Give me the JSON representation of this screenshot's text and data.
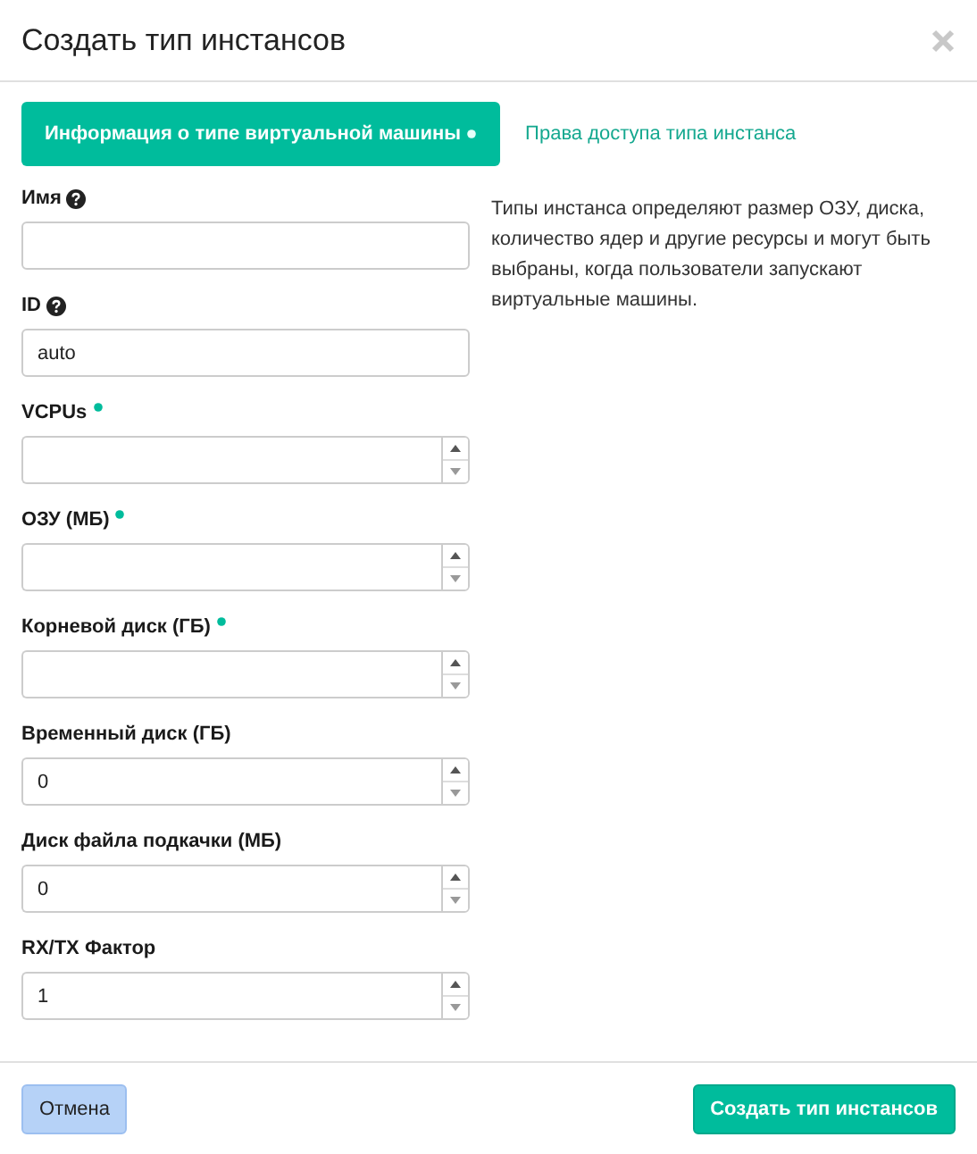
{
  "window": {
    "title": "Создать тип инстансов"
  },
  "tabs": [
    {
      "label": "Информация о типе виртуальной машины",
      "selected": true,
      "required": true
    },
    {
      "label": "Права доступа типа инстанса",
      "selected": false,
      "required": false
    }
  ],
  "fields": [
    {
      "label": "Имя",
      "kind": "text",
      "help": true,
      "required": false
    },
    {
      "label": "ID",
      "kind": "text",
      "help": true,
      "required": false,
      "value": "auto"
    },
    {
      "label": "VCPUs",
      "kind": "number",
      "help": false,
      "required": true
    },
    {
      "label": "ОЗУ (МБ)",
      "kind": "number",
      "help": false,
      "required": true
    },
    {
      "label": "Корневой диск (ГБ)",
      "kind": "number",
      "help": false,
      "required": true
    },
    {
      "label": "Временный диск (ГБ)",
      "kind": "number",
      "help": false,
      "required": false,
      "value": "0"
    },
    {
      "label": "Диск файла подкачки (МБ)",
      "kind": "number",
      "help": false,
      "required": false,
      "value": "0"
    },
    {
      "label": "RX/TX Фактор",
      "kind": "number",
      "help": false,
      "required": false,
      "value": "1"
    }
  ],
  "description": "Типы инстанса определяют размер ОЗУ, диска, количество ядер и другие ресурсы и могут быть выбраны, когда пользователи запускают виртуальные машины.",
  "buttons": [
    {
      "label": "Отмена",
      "kind": "secondary"
    },
    {
      "label": "Создать тип инстансов",
      "kind": "primary"
    }
  ]
}
